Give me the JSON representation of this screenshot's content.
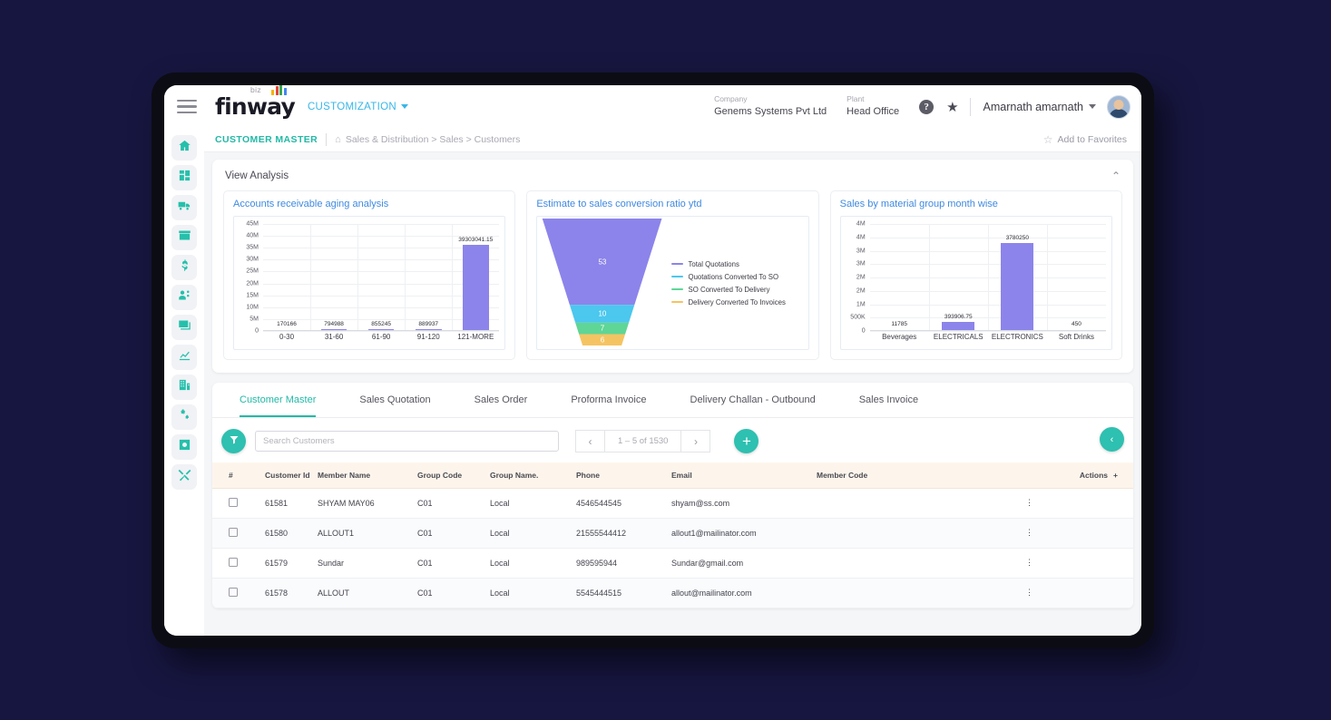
{
  "brand": {
    "word": "finway",
    "biz": "biz",
    "customization": "CUSTOMIZATION"
  },
  "topbar": {
    "company_label": "Company",
    "company_value": "Genems Systems Pvt Ltd",
    "plant_label": "Plant",
    "plant_value": "Head Office",
    "help_icon": "?",
    "star_icon": "★",
    "username": "Amarnath amarnath"
  },
  "breadcrumb": {
    "title": "CUSTOMER MASTER",
    "home_icon": "⌂",
    "path": "Sales & Distribution > Sales > Customers",
    "favorite_icon": "☆",
    "favorite_text": "Add to Favorites"
  },
  "sidebar": {
    "items": [
      {
        "name": "home-icon",
        "label": "Home"
      },
      {
        "name": "dashboard-icon",
        "label": "Dashboard"
      },
      {
        "name": "truck-icon",
        "label": "Logistics"
      },
      {
        "name": "store-icon",
        "label": "Store"
      },
      {
        "name": "dollar-icon",
        "label": "Finance"
      },
      {
        "name": "user-settings-icon",
        "label": "Users"
      },
      {
        "name": "cards-icon",
        "label": "Cards"
      },
      {
        "name": "analytics-icon",
        "label": "Analytics"
      },
      {
        "name": "building-icon",
        "label": "Organization"
      },
      {
        "name": "gears-icon",
        "label": "Settings"
      },
      {
        "name": "settings-square-icon",
        "label": "Configuration"
      },
      {
        "name": "tools-icon",
        "label": "Tools"
      }
    ]
  },
  "analysis": {
    "title": "View Analysis",
    "collapse_icon": "⌃"
  },
  "chart_data": [
    {
      "type": "bar",
      "title": "Accounts receivable aging analysis",
      "categories": [
        "0-30",
        "31-60",
        "61-90",
        "91-120",
        "121-MORE"
      ],
      "values": [
        170166,
        794988,
        855245,
        889937,
        39303041.15
      ],
      "value_labels": [
        "170166",
        "794988",
        "855245",
        "889937",
        "39303041.15"
      ],
      "ytick_labels": [
        "45M",
        "40M",
        "35M",
        "30M",
        "25M",
        "20M",
        "15M",
        "10M",
        "5M",
        "0"
      ],
      "ylim": [
        0,
        45000000
      ],
      "xlabel": "",
      "ylabel": "",
      "grid": true,
      "bar_color": "#8c84ea"
    },
    {
      "type": "funnel",
      "title": "Estimate to sales conversion ratio ytd",
      "stages": [
        {
          "label": "Total Quotations",
          "value": 53,
          "color": "#8c84ea"
        },
        {
          "label": "Quotations Converted To SO",
          "value": 10,
          "color": "#4cc7ee"
        },
        {
          "label": "SO Converted To Delivery",
          "value": 7,
          "color": "#5fd696"
        },
        {
          "label": "Delivery Converted To Invoices",
          "value": 6,
          "color": "#f5c462"
        }
      ],
      "legend_position": "right"
    },
    {
      "type": "bar",
      "title": "Sales by material group month wise",
      "categories": [
        "Beverages",
        "ELECTRICALS",
        "ELECTRONICS",
        "Soft Drinks"
      ],
      "values": [
        11785,
        393906.75,
        3780250,
        450
      ],
      "value_labels": [
        "11785",
        "393906.75",
        "3780250",
        "450"
      ],
      "ytick_labels": [
        "4M",
        "4M",
        "3M",
        "3M",
        "2M",
        "2M",
        "1M",
        "500K",
        "0"
      ],
      "ylim": [
        0,
        4000000
      ],
      "xlabel": "",
      "ylabel": "",
      "grid": true,
      "bar_color": "#8c84ea"
    }
  ],
  "tabs": [
    {
      "label": "Customer Master",
      "active": true
    },
    {
      "label": "Sales Quotation",
      "active": false
    },
    {
      "label": "Sales Order",
      "active": false
    },
    {
      "label": "Proforma Invoice",
      "active": false
    },
    {
      "label": "Delivery Challan - Outbound",
      "active": false
    },
    {
      "label": "Sales Invoice",
      "active": false
    }
  ],
  "toolbar": {
    "filter_icon": "filter-icon",
    "search_placeholder": "Search Customers",
    "search_value": "",
    "prev_icon": "‹",
    "next_icon": "›",
    "page_label": "1 – 5 of 1530",
    "add_icon": "+",
    "collapse_icon": "‹"
  },
  "table": {
    "headers": [
      "#",
      "Customer Id",
      "Member Name",
      "Group Code",
      "Group Name.",
      "Phone",
      "Email",
      "Member Code",
      "Actions"
    ],
    "add_column_icon": "+",
    "rows": [
      {
        "customer_id": "61581",
        "member_name": "SHYAM MAY06",
        "group_code": "C01",
        "group_name": "Local",
        "phone": "4546544545",
        "email": "shyam@ss.com",
        "member_code": ""
      },
      {
        "customer_id": "61580",
        "member_name": "ALLOUT1",
        "group_code": "C01",
        "group_name": "Local",
        "phone": "21555544412",
        "email": "allout1@mailinator.com",
        "member_code": ""
      },
      {
        "customer_id": "61579",
        "member_name": "Sundar",
        "group_code": "C01",
        "group_name": "Local",
        "phone": "989595944",
        "email": "Sundar@gmail.com",
        "member_code": ""
      },
      {
        "customer_id": "61578",
        "member_name": "ALLOUT",
        "group_code": "C01",
        "group_name": "Local",
        "phone": "5545444515",
        "email": "allout@mailinator.com",
        "member_code": ""
      }
    ]
  },
  "colors": {
    "accent_teal": "#2ec0b0",
    "accent_blue": "#3f8ae0",
    "bar_purple": "#8c84ea",
    "page_bg": "#171640"
  }
}
